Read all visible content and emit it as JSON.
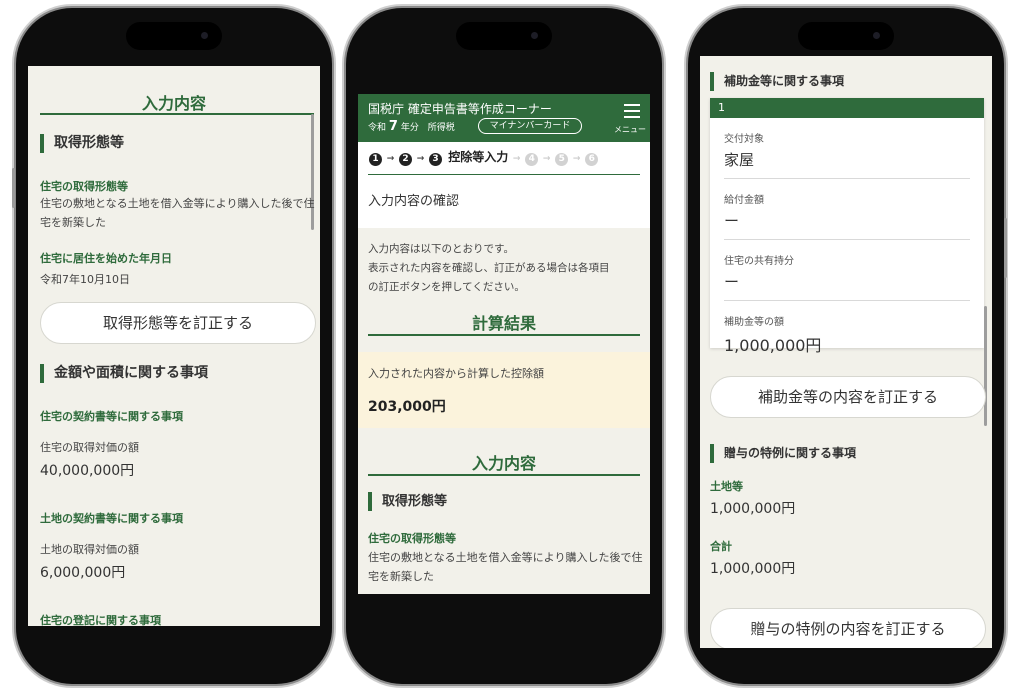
{
  "phone1": {
    "section_header": "入力内容",
    "acq_title": "取得形態等",
    "acq_type_label": "住宅の取得形態等",
    "acq_type_value": "住宅の敷地となる土地を借入金等により購入した後で住宅を新築した",
    "move_in_label": "住宅に居住を始めた年月日",
    "move_in_value": "令和7年10月10日",
    "correct_acq_button": "取得形態等を訂正する",
    "amount_title": "金額や面積に関する事項",
    "house_contract_label": "住宅の契約書等に関する事項",
    "house_price_label": "住宅の取得対価の額",
    "house_price_value": "40,000,000円",
    "land_contract_label": "土地の契約書等に関する事項",
    "land_price_label": "土地の取得対価の額",
    "land_price_value": "6,000,000円",
    "registration_label": "住宅の登記に関する事項"
  },
  "phone2": {
    "app_title": "国税庁 確定申告書等作成コーナー",
    "year_prefix": "令和",
    "year_number": "7",
    "year_suffix": "年分",
    "tax_type": "所得税",
    "mynumber_badge": "マイナンバーカード",
    "menu_label": "メニュー",
    "steps": [
      "1",
      "2",
      "3",
      "4",
      "5",
      "6"
    ],
    "current_step_label": "控除等入力",
    "page_title": "入力内容の確認",
    "intro_line1": "入力内容は以下のとおりです。",
    "intro_line2": "表示された内容を確認し、訂正がある場合は各項目",
    "intro_line3": "の訂正ボタンを押してください。",
    "calc_header": "計算結果",
    "deduction_label": "入力された内容から計算した控除額",
    "deduction_value": "203,000円",
    "input_header": "入力内容",
    "acq_title": "取得形態等",
    "acq_type_label": "住宅の取得形態等",
    "acq_type_value": "住宅の敷地となる土地を借入金等により購入した後で住宅を新築した"
  },
  "phone3": {
    "subsidy_title": "補助金等に関する事項",
    "row_number": "1",
    "target_label": "交付対象",
    "target_value": "家屋",
    "benefit_label": "給付金額",
    "benefit_value": "ー",
    "share_label": "住宅の共有持分",
    "share_value": "ー",
    "subsidy_amount_label": "補助金等の額",
    "subsidy_amount_value": "1,000,000円",
    "correct_subsidy_button": "補助金等の内容を訂正する",
    "gift_title": "贈与の特例に関する事項",
    "land_label": "土地等",
    "land_value": "1,000,000円",
    "total_label": "合計",
    "total_value": "1,000,000円",
    "correct_gift_button": "贈与の特例の内容を訂正する"
  }
}
